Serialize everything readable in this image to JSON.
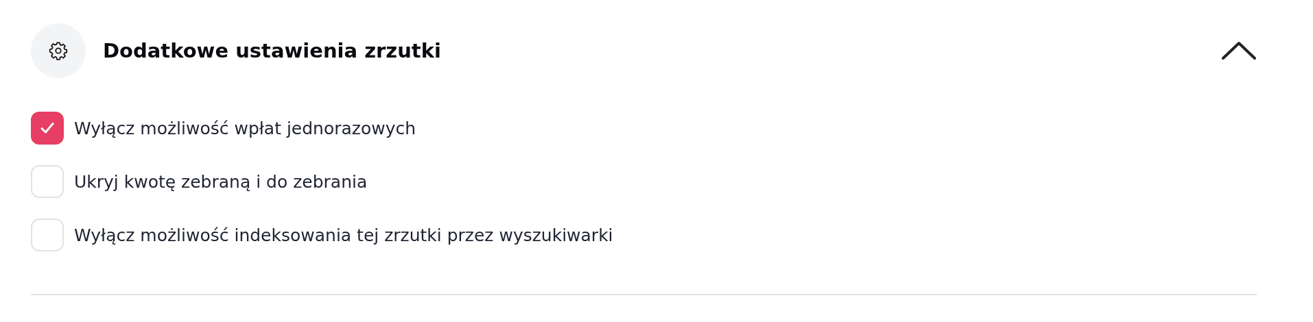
{
  "section": {
    "title": "Dodatkowe ustawienia zrzutki",
    "expanded": true,
    "options": [
      {
        "label": "Wyłącz możliwość wpłat jednorazowych",
        "checked": true
      },
      {
        "label": "Ukryj kwotę zebraną i do zebrania",
        "checked": false
      },
      {
        "label": "Wyłącz możliwość indeksowania tej zrzutki przez wyszukiwarki",
        "checked": false
      }
    ]
  }
}
